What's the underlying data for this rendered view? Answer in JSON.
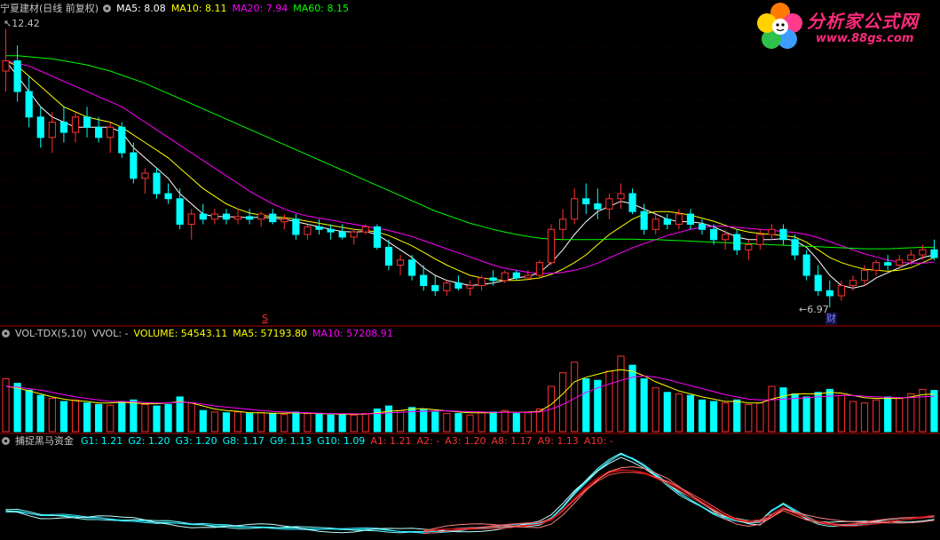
{
  "main": {
    "stock_title": "宁夏建材(日线 前复权)",
    "ma_labels": [
      {
        "text": "MA5: 8.08",
        "color": "#ffffff"
      },
      {
        "text": "MA10: 8.11",
        "color": "#ffff00"
      },
      {
        "text": "MA20: 7.94",
        "color": "#ff00ff"
      },
      {
        "text": "MA60: 8.15",
        "color": "#00ff00"
      }
    ],
    "high_label": "12.42",
    "low_label": "6.97",
    "cai_marker": "财",
    "s_marker": "S"
  },
  "volume": {
    "title": "VOL-TDX(5,10)",
    "vvol": "VVOL: -",
    "labels": [
      {
        "text": "VOLUME: 54543.11",
        "color": "#ffff00"
      },
      {
        "text": "MA5: 57193.80",
        "color": "#ffff00"
      },
      {
        "text": "MA10: 57208.91",
        "color": "#ff00ff"
      }
    ]
  },
  "indicator": {
    "title": "捕捉黑马资金",
    "labels": [
      {
        "text": "G1: 1.21",
        "color": "#00ffff"
      },
      {
        "text": "G2: 1.20",
        "color": "#00ffff"
      },
      {
        "text": "G3: 1.20",
        "color": "#00ffff"
      },
      {
        "text": "G8: 1.17",
        "color": "#00ffff"
      },
      {
        "text": "G9: 1.13",
        "color": "#00ffff"
      },
      {
        "text": "G10: 1.09",
        "color": "#00ffff"
      },
      {
        "text": "A1: 1.21",
        "color": "#ff3030"
      },
      {
        "text": "A2: -",
        "color": "#ff3030"
      },
      {
        "text": "A3: 1.20",
        "color": "#ff3030"
      },
      {
        "text": "A8: 1.17",
        "color": "#ff3030"
      },
      {
        "text": "A9: 1.13",
        "color": "#ff3030"
      },
      {
        "text": "A10: -",
        "color": "#ff3030"
      }
    ]
  },
  "logo": {
    "text": "分析家公式网",
    "url_text": "www.88gs.com"
  },
  "chart_data": {
    "type": "candlestick",
    "price_range": [
      6.97,
      12.42
    ],
    "ohlc": [
      [
        11.6,
        12.42,
        11.2,
        11.8
      ],
      [
        11.8,
        12.1,
        11.0,
        11.2
      ],
      [
        11.2,
        11.5,
        10.5,
        10.7
      ],
      [
        10.7,
        10.9,
        10.1,
        10.3
      ],
      [
        10.3,
        10.8,
        10.0,
        10.6
      ],
      [
        10.6,
        10.9,
        10.2,
        10.4
      ],
      [
        10.4,
        10.8,
        10.2,
        10.7
      ],
      [
        10.7,
        10.9,
        10.3,
        10.5
      ],
      [
        10.5,
        10.7,
        10.2,
        10.3
      ],
      [
        10.3,
        10.6,
        10.0,
        10.5
      ],
      [
        10.5,
        10.6,
        9.9,
        10.0
      ],
      [
        10.0,
        10.2,
        9.4,
        9.5
      ],
      [
        9.5,
        9.7,
        9.2,
        9.6
      ],
      [
        9.6,
        9.7,
        9.1,
        9.2
      ],
      [
        9.2,
        9.4,
        9.0,
        9.1
      ],
      [
        9.1,
        9.3,
        8.5,
        8.6
      ],
      [
        8.6,
        8.9,
        8.3,
        8.8
      ],
      [
        8.8,
        9.0,
        8.6,
        8.7
      ],
      [
        8.7,
        8.9,
        8.6,
        8.8
      ],
      [
        8.8,
        8.9,
        8.6,
        8.7
      ],
      [
        8.7,
        8.9,
        8.6,
        8.75
      ],
      [
        8.75,
        8.9,
        8.6,
        8.7
      ],
      [
        8.7,
        8.85,
        8.55,
        8.8
      ],
      [
        8.8,
        8.9,
        8.6,
        8.65
      ],
      [
        8.65,
        8.8,
        8.5,
        8.7
      ],
      [
        8.7,
        8.8,
        8.3,
        8.4
      ],
      [
        8.4,
        8.6,
        8.3,
        8.55
      ],
      [
        8.55,
        8.7,
        8.4,
        8.5
      ],
      [
        8.5,
        8.6,
        8.3,
        8.45
      ],
      [
        8.45,
        8.6,
        8.3,
        8.35
      ],
      [
        8.35,
        8.5,
        8.2,
        8.45
      ],
      [
        8.45,
        8.6,
        8.4,
        8.55
      ],
      [
        8.55,
        8.6,
        8.1,
        8.15
      ],
      [
        8.15,
        8.3,
        7.7,
        7.8
      ],
      [
        7.8,
        8.0,
        7.6,
        7.9
      ],
      [
        7.9,
        8.0,
        7.5,
        7.6
      ],
      [
        7.6,
        7.8,
        7.3,
        7.4
      ],
      [
        7.4,
        7.6,
        7.2,
        7.3
      ],
      [
        7.3,
        7.5,
        7.2,
        7.45
      ],
      [
        7.45,
        7.6,
        7.3,
        7.35
      ],
      [
        7.35,
        7.5,
        7.2,
        7.4
      ],
      [
        7.4,
        7.6,
        7.3,
        7.55
      ],
      [
        7.55,
        7.7,
        7.4,
        7.5
      ],
      [
        7.5,
        7.7,
        7.45,
        7.65
      ],
      [
        7.65,
        7.7,
        7.5,
        7.55
      ],
      [
        7.55,
        7.7,
        7.5,
        7.6
      ],
      [
        7.6,
        7.9,
        7.55,
        7.85
      ],
      [
        7.85,
        8.6,
        7.8,
        8.5
      ],
      [
        8.5,
        8.9,
        8.3,
        8.7
      ],
      [
        8.7,
        9.3,
        8.6,
        9.1
      ],
      [
        9.1,
        9.4,
        8.8,
        9.0
      ],
      [
        9.0,
        9.3,
        8.7,
        8.9
      ],
      [
        8.9,
        9.2,
        8.7,
        9.1
      ],
      [
        9.1,
        9.4,
        8.9,
        9.2
      ],
      [
        9.2,
        9.3,
        8.8,
        8.85
      ],
      [
        8.85,
        9.0,
        8.4,
        8.5
      ],
      [
        8.5,
        8.8,
        8.4,
        8.7
      ],
      [
        8.7,
        8.8,
        8.5,
        8.6
      ],
      [
        8.6,
        8.9,
        8.5,
        8.8
      ],
      [
        8.8,
        8.9,
        8.5,
        8.6
      ],
      [
        8.6,
        8.7,
        8.4,
        8.5
      ],
      [
        8.5,
        8.6,
        8.2,
        8.3
      ],
      [
        8.3,
        8.5,
        8.1,
        8.4
      ],
      [
        8.4,
        8.5,
        8.0,
        8.1
      ],
      [
        8.1,
        8.3,
        7.9,
        8.2
      ],
      [
        8.2,
        8.5,
        8.1,
        8.4
      ],
      [
        8.4,
        8.6,
        8.3,
        8.5
      ],
      [
        8.5,
        8.6,
        8.2,
        8.3
      ],
      [
        8.3,
        8.4,
        7.9,
        8.0
      ],
      [
        8.0,
        8.1,
        7.5,
        7.6
      ],
      [
        7.6,
        7.8,
        7.2,
        7.3
      ],
      [
        7.3,
        7.5,
        6.97,
        7.2
      ],
      [
        7.2,
        7.5,
        7.1,
        7.4
      ],
      [
        7.4,
        7.6,
        7.3,
        7.5
      ],
      [
        7.5,
        7.8,
        7.4,
        7.7
      ],
      [
        7.7,
        7.9,
        7.6,
        7.85
      ],
      [
        7.85,
        8.0,
        7.7,
        7.8
      ],
      [
        7.8,
        8.0,
        7.7,
        7.9
      ],
      [
        7.9,
        8.1,
        7.8,
        8.0
      ],
      [
        8.0,
        8.2,
        7.9,
        8.1
      ],
      [
        8.1,
        8.3,
        7.9,
        7.95
      ]
    ],
    "ma": {
      "MA5": {
        "color": "#ffffff",
        "values": [
          11.8,
          11.5,
          11.2,
          10.9,
          10.7,
          10.6,
          10.5,
          10.5,
          10.5,
          10.5,
          10.4,
          10.1,
          9.9,
          9.7,
          9.5,
          9.2,
          9.0,
          8.8,
          8.75,
          8.75,
          8.74,
          8.73,
          8.74,
          8.72,
          8.7,
          8.65,
          8.6,
          8.55,
          8.5,
          8.46,
          8.45,
          8.46,
          8.4,
          8.25,
          8.1,
          7.95,
          7.75,
          7.6,
          7.5,
          7.45,
          7.4,
          7.42,
          7.45,
          7.5,
          7.55,
          7.58,
          7.65,
          7.85,
          8.1,
          8.4,
          8.65,
          8.85,
          8.95,
          9.05,
          9.0,
          8.9,
          8.8,
          8.7,
          8.65,
          8.65,
          8.62,
          8.55,
          8.45,
          8.35,
          8.3,
          8.3,
          8.3,
          8.32,
          8.28,
          8.15,
          7.9,
          7.6,
          7.4,
          7.35,
          7.4,
          7.55,
          7.65,
          7.75,
          7.85,
          7.95,
          8.0
        ]
      },
      "MA10": {
        "color": "#ffff00",
        "values": [
          11.8,
          11.7,
          11.5,
          11.3,
          11.1,
          10.9,
          10.8,
          10.7,
          10.65,
          10.6,
          10.5,
          10.35,
          10.2,
          10.05,
          9.9,
          9.7,
          9.5,
          9.3,
          9.15,
          9.0,
          8.9,
          8.82,
          8.78,
          8.75,
          8.73,
          8.7,
          8.66,
          8.62,
          8.58,
          8.54,
          8.5,
          8.48,
          8.45,
          8.38,
          8.28,
          8.18,
          8.05,
          7.92,
          7.8,
          7.7,
          7.6,
          7.55,
          7.52,
          7.5,
          7.5,
          7.52,
          7.55,
          7.62,
          7.72,
          7.85,
          8.0,
          8.2,
          8.4,
          8.55,
          8.7,
          8.8,
          8.85,
          8.85,
          8.82,
          8.78,
          8.72,
          8.66,
          8.58,
          8.5,
          8.45,
          8.42,
          8.4,
          8.38,
          8.35,
          8.25,
          8.1,
          7.95,
          7.85,
          7.78,
          7.72,
          7.7,
          7.68,
          7.7,
          7.75,
          7.85,
          7.95
        ]
      },
      "MA20": {
        "color": "#ff00ff",
        "values": [
          11.8,
          11.75,
          11.7,
          11.6,
          11.5,
          11.4,
          11.3,
          11.2,
          11.1,
          11.0,
          10.9,
          10.75,
          10.6,
          10.45,
          10.3,
          10.15,
          10.0,
          9.85,
          9.7,
          9.55,
          9.4,
          9.25,
          9.12,
          9.0,
          8.9,
          8.82,
          8.76,
          8.72,
          8.68,
          8.64,
          8.6,
          8.56,
          8.52,
          8.48,
          8.42,
          8.36,
          8.28,
          8.2,
          8.12,
          8.04,
          7.96,
          7.88,
          7.8,
          7.74,
          7.7,
          7.66,
          7.64,
          7.64,
          7.66,
          7.7,
          7.76,
          7.84,
          7.94,
          8.04,
          8.14,
          8.22,
          8.3,
          8.38,
          8.44,
          8.5,
          8.54,
          8.56,
          8.56,
          8.54,
          8.52,
          8.5,
          8.48,
          8.46,
          8.44,
          8.4,
          8.34,
          8.26,
          8.18,
          8.1,
          8.02,
          7.96,
          7.9,
          7.86,
          7.84,
          7.84,
          7.86
        ]
      },
      "MA60": {
        "color": "#00ff00",
        "values": [
          11.9,
          11.9,
          11.88,
          11.86,
          11.84,
          11.8,
          11.76,
          11.72,
          11.66,
          11.6,
          11.52,
          11.44,
          11.36,
          11.26,
          11.16,
          11.06,
          10.96,
          10.86,
          10.76,
          10.66,
          10.56,
          10.46,
          10.36,
          10.26,
          10.16,
          10.06,
          9.96,
          9.86,
          9.76,
          9.66,
          9.56,
          9.46,
          9.36,
          9.26,
          9.16,
          9.06,
          8.96,
          8.86,
          8.78,
          8.7,
          8.62,
          8.56,
          8.5,
          8.45,
          8.4,
          8.36,
          8.33,
          8.31,
          8.3,
          8.3,
          8.3,
          8.3,
          8.31,
          8.31,
          8.31,
          8.3,
          8.3,
          8.29,
          8.28,
          8.27,
          8.26,
          8.25,
          8.24,
          8.23,
          8.22,
          8.21,
          8.2,
          8.19,
          8.18,
          8.17,
          8.16,
          8.15,
          8.14,
          8.13,
          8.12,
          8.12,
          8.12,
          8.13,
          8.14,
          8.15,
          8.15
        ]
      }
    },
    "volume": {
      "colors": {
        "up": "#ff3030",
        "down": "#00ffff"
      },
      "range": [
        0,
        120000
      ],
      "values": [
        70000,
        64000,
        55000,
        48000,
        44000,
        40000,
        42000,
        38000,
        36000,
        35000,
        40000,
        42000,
        36000,
        34000,
        36000,
        46000,
        38000,
        28000,
        26000,
        25000,
        26000,
        24000,
        25000,
        24000,
        23000,
        26000,
        24000,
        23000,
        22000,
        23000,
        22000,
        24000,
        30000,
        34000,
        28000,
        32000,
        30000,
        26000,
        24000,
        24000,
        22000,
        26000,
        26000,
        28000,
        24000,
        25000,
        30000,
        60000,
        78000,
        92000,
        70000,
        68000,
        80000,
        100000,
        88000,
        70000,
        58000,
        52000,
        50000,
        48000,
        42000,
        40000,
        38000,
        42000,
        36000,
        38000,
        60000,
        58000,
        50000,
        46000,
        52000,
        56000,
        48000,
        40000,
        38000,
        42000,
        46000,
        44000,
        50000,
        56000,
        54543
      ],
      "ma5": [
        60000,
        58000,
        54000,
        50000,
        46000,
        43000,
        41000,
        40000,
        38000,
        38000,
        39000,
        38000,
        37000,
        37000,
        38000,
        40000,
        38000,
        34000,
        30000,
        28000,
        27000,
        25000,
        25000,
        24500,
        24500,
        25000,
        24500,
        24000,
        23500,
        23000,
        23000,
        23000,
        25000,
        27000,
        28000,
        30000,
        30500,
        29000,
        27500,
        26000,
        25000,
        25000,
        25000,
        26000,
        25500,
        26000,
        27000,
        36000,
        50000,
        66000,
        72000,
        76000,
        80000,
        82000,
        80000,
        74000,
        66000,
        60000,
        54000,
        50000,
        46000,
        43000,
        40000,
        40000,
        38000,
        38000,
        43000,
        47000,
        50000,
        50000,
        50000,
        52000,
        51000,
        48000,
        45000,
        44000,
        44000,
        44000,
        46000,
        49000,
        50000
      ],
      "ma10": [
        60000,
        59000,
        57000,
        55000,
        52000,
        49000,
        46000,
        44000,
        42000,
        40000,
        40000,
        39500,
        38500,
        38000,
        38000,
        39000,
        38500,
        36500,
        34000,
        32500,
        31000,
        29500,
        28000,
        27000,
        26000,
        25500,
        25000,
        24500,
        24000,
        23800,
        23600,
        23500,
        24000,
        25000,
        25500,
        26500,
        27000,
        27500,
        27500,
        27000,
        26500,
        26000,
        25500,
        25500,
        25500,
        25500,
        26000,
        30000,
        36000,
        44000,
        52000,
        58000,
        63000,
        68000,
        72000,
        74000,
        72000,
        69000,
        65000,
        61000,
        57000,
        53000,
        49000,
        46000,
        43000,
        42000,
        42000,
        43000,
        44000,
        45000,
        46000,
        47000,
        48000,
        48000,
        47000,
        46000,
        45500,
        45000,
        45000,
        46000,
        47000
      ]
    },
    "indicator": {
      "range": [
        0.9,
        1.3
      ],
      "G": [
        1.02,
        1.02,
        1.01,
        1.0,
        1.0,
        1.0,
        0.995,
        0.99,
        0.99,
        0.985,
        0.98,
        0.98,
        0.975,
        0.97,
        0.97,
        0.965,
        0.96,
        0.96,
        0.955,
        0.955,
        0.95,
        0.95,
        0.95,
        0.948,
        0.945,
        0.945,
        0.942,
        0.94,
        0.94,
        0.938,
        0.938,
        0.94,
        0.94,
        0.935,
        0.93,
        0.93,
        0.928,
        0.93,
        0.932,
        0.935,
        0.94,
        0.944,
        0.948,
        0.952,
        0.956,
        0.96,
        0.965,
        0.99,
        1.04,
        1.1,
        1.15,
        1.2,
        1.24,
        1.27,
        1.25,
        1.22,
        1.18,
        1.14,
        1.1,
        1.07,
        1.04,
        1.01,
        0.99,
        0.98,
        0.97,
        0.97,
        1.02,
        1.05,
        1.02,
        0.99,
        0.97,
        0.96,
        0.96,
        0.96,
        0.965,
        0.97,
        0.975,
        0.98,
        0.985,
        0.99,
        0.995
      ],
      "A": [
        0,
        0,
        0,
        0,
        0,
        0,
        0,
        0,
        0,
        0,
        0,
        0,
        0,
        0,
        0,
        0,
        0,
        0,
        0,
        0,
        0,
        0,
        0,
        0,
        0,
        0,
        0,
        0,
        0,
        0,
        0,
        0,
        0,
        0,
        0,
        0,
        0.93,
        0.935,
        0.94,
        0.942,
        0.945,
        0.948,
        0.95,
        0.952,
        0.955,
        0.958,
        0.962,
        0.98,
        1.02,
        1.07,
        1.12,
        1.16,
        1.19,
        1.2,
        1.2,
        1.19,
        1.17,
        1.15,
        1.12,
        1.09,
        1.06,
        1.03,
        1.0,
        0.98,
        0.97,
        0.975,
        1.0,
        1.03,
        1.01,
        0.99,
        0.975,
        0.965,
        0.96,
        0.96,
        0.965,
        0.97,
        0.975,
        0.98,
        0.985,
        0.99,
        0.995
      ]
    }
  }
}
